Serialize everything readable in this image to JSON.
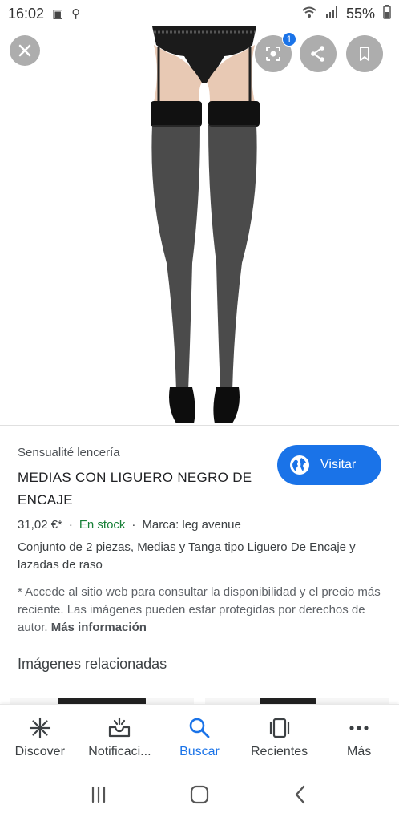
{
  "status_bar": {
    "time": "16:02",
    "battery": "55%"
  },
  "viewer": {
    "lens_badge": "1"
  },
  "product": {
    "source": "Sensualité lencería",
    "title": "MEDIAS CON LIGUERO NEGRO DE ENCAJE",
    "visit_label": "Visitar",
    "price": "31,02 €*",
    "stock": "En stock",
    "brand": "Marca: leg avenue",
    "description": "Conjunto de 2 piezas, Medias y Tanga tipo Liguero De Encaje y lazadas de raso",
    "disclaimer": "* Accede al sitio web para consultar la disponibilidad y el precio más reciente. Las imágenes pueden estar protegidas por derechos de autor.",
    "more_info": "Más información"
  },
  "related": {
    "title": "Imágenes relacionadas"
  },
  "bottom_nav": {
    "items": [
      {
        "label": "Discover",
        "icon": "asterisk-icon"
      },
      {
        "label": "Notificaci...",
        "icon": "inbox-icon"
      },
      {
        "label": "Buscar",
        "icon": "search-icon"
      },
      {
        "label": "Recientes",
        "icon": "tabs-icon"
      },
      {
        "label": "Más",
        "icon": "more-icon"
      }
    ],
    "active_index": 2
  },
  "colors": {
    "accent": "#1a73e8",
    "stock": "#188038"
  }
}
